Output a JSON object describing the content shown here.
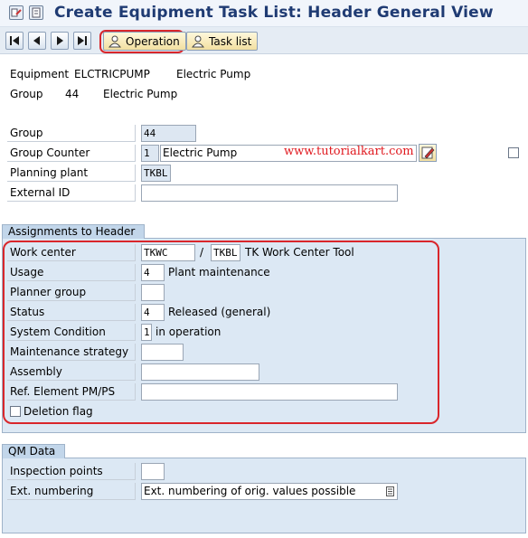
{
  "window": {
    "title": "Create Equipment Task List: Header General View"
  },
  "toolbar": {
    "first": "first-page",
    "prev": "previous-page",
    "next": "next-page",
    "last": "last-page",
    "operation_label": "Operation",
    "tasklist_label": "Task list"
  },
  "header_info": {
    "equipment_label": "Equipment",
    "equipment_id": "ELCTRICPUMP",
    "equipment_desc": "Electric Pump",
    "group_label": "Group",
    "group_id": "44",
    "group_desc": "Electric Pump"
  },
  "general": {
    "group": {
      "label": "Group",
      "value": "44"
    },
    "group_counter": {
      "label": "Group Counter",
      "value": "1",
      "description": "Electric Pump"
    },
    "planning_plant": {
      "label": "Planning plant",
      "value": "TKBL"
    },
    "external_id": {
      "label": "External ID",
      "value": ""
    }
  },
  "watermark": "www.tutorialkart.com",
  "assignments": {
    "title": "Assignments to Header",
    "work_center": {
      "label": "Work center",
      "value": "TKWC",
      "plant": "TKBL",
      "description": "TK Work Center Tool"
    },
    "usage": {
      "label": "Usage",
      "value": "4",
      "description": "Plant maintenance"
    },
    "planner_group": {
      "label": "Planner group",
      "value": ""
    },
    "status": {
      "label": "Status",
      "value": "4",
      "description": "Released (general)"
    },
    "system_condition": {
      "label": "System Condition",
      "value": "1",
      "description": "in operation"
    },
    "maintenance_strategy": {
      "label": "Maintenance strategy",
      "value": ""
    },
    "assembly": {
      "label": "Assembly",
      "value": ""
    },
    "ref_element": {
      "label": "Ref. Element PM/PS",
      "value": ""
    },
    "deletion_flag": {
      "label": "Deletion flag",
      "checked": false
    }
  },
  "qm": {
    "title": "QM Data",
    "inspection_points": {
      "label": "Inspection points",
      "value": ""
    },
    "ext_numbering": {
      "label": "Ext. numbering",
      "value": "Ext. numbering of orig. values possible"
    }
  },
  "colors": {
    "title": "#1f3b73",
    "highlight": "#d9262b",
    "watermark": "#e0191f",
    "section_bg": "#dce8f4"
  }
}
